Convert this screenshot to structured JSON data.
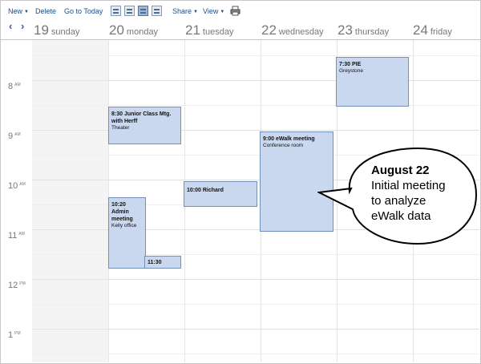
{
  "toolbar": {
    "new_label": "New",
    "delete_label": "Delete",
    "go_to_today_label": "Go to Today",
    "share_label": "Share",
    "view_label": "View"
  },
  "days": [
    {
      "num": "19",
      "name": "sunday"
    },
    {
      "num": "20",
      "name": "monday"
    },
    {
      "num": "21",
      "name": "tuesday"
    },
    {
      "num": "22",
      "name": "wednesday"
    },
    {
      "num": "23",
      "name": "thursday"
    },
    {
      "num": "24",
      "name": "friday"
    }
  ],
  "times": [
    {
      "hour": "8",
      "ampm": "AM"
    },
    {
      "hour": "9",
      "ampm": "AM"
    },
    {
      "hour": "10",
      "ampm": "AM"
    },
    {
      "hour": "11",
      "ampm": "AM"
    },
    {
      "hour": "12",
      "ampm": "PM"
    },
    {
      "hour": "1",
      "ampm": "PM"
    }
  ],
  "appointments": [
    {
      "title": "8:30 Junior Class Mtg. with Herff",
      "location": "Theater"
    },
    {
      "title": "10:20 Admin meeting",
      "location": "Kelly office"
    },
    {
      "title": "11:30",
      "location": ""
    },
    {
      "title": "10:00 Richard",
      "location": ""
    },
    {
      "title": "9:00 eWalk meeting",
      "location": "Conference room"
    },
    {
      "title": "7:30 PIE",
      "location": "Greystone"
    }
  ],
  "callout": {
    "heading": "August 22",
    "line1": "Initial meeting",
    "line2": "to analyze",
    "line3": "eWalk data"
  },
  "colors": {
    "accent": "#1a4f8a",
    "appointment_fill": "#c9d8ee",
    "appointment_border": "#7390b9"
  }
}
